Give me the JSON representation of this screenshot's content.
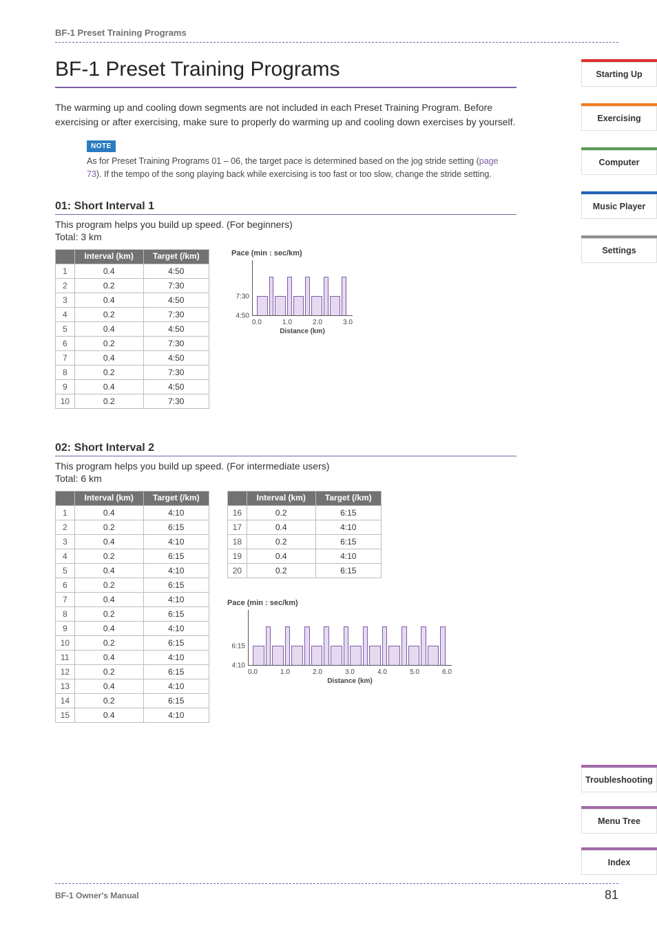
{
  "running_head": "BF-1 Preset Training Programs",
  "page_title": "BF-1 Preset Training Programs",
  "intro": "The warming up and cooling down segments are not included in each Preset Training Program. Before exercising or after exercising, make sure to properly do warming up and cooling down exercises by yourself.",
  "note": {
    "tag": "NOTE",
    "text_a": "As for Preset Training Programs 01 – 06, the target pace is determined based on the jog stride setting (",
    "link": "page 73",
    "text_b": "). If the tempo of the song playing back while exercising is too fast or too slow, change the stride setting."
  },
  "table_headers": {
    "idx": "",
    "interval": "Interval (km)",
    "target": "Target (/km)"
  },
  "program01": {
    "title": "01: Short Interval 1",
    "desc": "This program helps you build up speed. (For beginners)",
    "total": "Total: 3 km",
    "rows": [
      {
        "n": "1",
        "interval": "0.4",
        "target": "4:50"
      },
      {
        "n": "2",
        "interval": "0.2",
        "target": "7:30"
      },
      {
        "n": "3",
        "interval": "0.4",
        "target": "4:50"
      },
      {
        "n": "4",
        "interval": "0.2",
        "target": "7:30"
      },
      {
        "n": "5",
        "interval": "0.4",
        "target": "4:50"
      },
      {
        "n": "6",
        "interval": "0.2",
        "target": "7:30"
      },
      {
        "n": "7",
        "interval": "0.4",
        "target": "4:50"
      },
      {
        "n": "8",
        "interval": "0.2",
        "target": "7:30"
      },
      {
        "n": "9",
        "interval": "0.4",
        "target": "4:50"
      },
      {
        "n": "10",
        "interval": "0.2",
        "target": "7:30"
      }
    ]
  },
  "program02": {
    "title": "02: Short Interval 2",
    "desc": "This program helps you build up speed. (For intermediate users)",
    "total": "Total: 6 km",
    "rows_a": [
      {
        "n": "1",
        "interval": "0.4",
        "target": "4:10"
      },
      {
        "n": "2",
        "interval": "0.2",
        "target": "6:15"
      },
      {
        "n": "3",
        "interval": "0.4",
        "target": "4:10"
      },
      {
        "n": "4",
        "interval": "0.2",
        "target": "6:15"
      },
      {
        "n": "5",
        "interval": "0.4",
        "target": "4:10"
      },
      {
        "n": "6",
        "interval": "0.2",
        "target": "6:15"
      },
      {
        "n": "7",
        "interval": "0.4",
        "target": "4:10"
      },
      {
        "n": "8",
        "interval": "0.2",
        "target": "6:15"
      },
      {
        "n": "9",
        "interval": "0.4",
        "target": "4:10"
      },
      {
        "n": "10",
        "interval": "0.2",
        "target": "6:15"
      },
      {
        "n": "11",
        "interval": "0.4",
        "target": "4:10"
      },
      {
        "n": "12",
        "interval": "0.2",
        "target": "6:15"
      },
      {
        "n": "13",
        "interval": "0.4",
        "target": "4:10"
      },
      {
        "n": "14",
        "interval": "0.2",
        "target": "6:15"
      },
      {
        "n": "15",
        "interval": "0.4",
        "target": "4:10"
      }
    ],
    "rows_b": [
      {
        "n": "16",
        "interval": "0.2",
        "target": "6:15"
      },
      {
        "n": "17",
        "interval": "0.4",
        "target": "4:10"
      },
      {
        "n": "18",
        "interval": "0.2",
        "target": "6:15"
      },
      {
        "n": "19",
        "interval": "0.4",
        "target": "4:10"
      },
      {
        "n": "20",
        "interval": "0.2",
        "target": "6:15"
      }
    ]
  },
  "chart_labels": {
    "title": "Pace (min : sec/km)",
    "xlabel": "Distance (km)"
  },
  "chart_data": [
    {
      "type": "bar",
      "title": "Pace (min : sec/km)",
      "xlabel": "Distance (km)",
      "ylabel": "Pace (min:sec/km)",
      "xlim": [
        0.0,
        3.0
      ],
      "x_ticks": [
        "0.0",
        "1.0",
        "2.0",
        "3.0"
      ],
      "y_ticks": [
        "4:50",
        "7:30"
      ],
      "segments": [
        {
          "width_km": 0.4,
          "pace": "4:50"
        },
        {
          "width_km": 0.2,
          "pace": "7:30"
        },
        {
          "width_km": 0.4,
          "pace": "4:50"
        },
        {
          "width_km": 0.2,
          "pace": "7:30"
        },
        {
          "width_km": 0.4,
          "pace": "4:50"
        },
        {
          "width_km": 0.2,
          "pace": "7:30"
        },
        {
          "width_km": 0.4,
          "pace": "4:50"
        },
        {
          "width_km": 0.2,
          "pace": "7:30"
        },
        {
          "width_km": 0.4,
          "pace": "4:50"
        },
        {
          "width_km": 0.2,
          "pace": "7:30"
        }
      ]
    },
    {
      "type": "bar",
      "title": "Pace (min : sec/km)",
      "xlabel": "Distance (km)",
      "ylabel": "Pace (min:sec/km)",
      "xlim": [
        0.0,
        6.0
      ],
      "x_ticks": [
        "0.0",
        "1.0",
        "2.0",
        "3.0",
        "4.0",
        "5.0",
        "6.0"
      ],
      "y_ticks": [
        "4:10",
        "6:15"
      ],
      "segments": [
        {
          "width_km": 0.4,
          "pace": "4:10"
        },
        {
          "width_km": 0.2,
          "pace": "6:15"
        },
        {
          "width_km": 0.4,
          "pace": "4:10"
        },
        {
          "width_km": 0.2,
          "pace": "6:15"
        },
        {
          "width_km": 0.4,
          "pace": "4:10"
        },
        {
          "width_km": 0.2,
          "pace": "6:15"
        },
        {
          "width_km": 0.4,
          "pace": "4:10"
        },
        {
          "width_km": 0.2,
          "pace": "6:15"
        },
        {
          "width_km": 0.4,
          "pace": "4:10"
        },
        {
          "width_km": 0.2,
          "pace": "6:15"
        },
        {
          "width_km": 0.4,
          "pace": "4:10"
        },
        {
          "width_km": 0.2,
          "pace": "6:15"
        },
        {
          "width_km": 0.4,
          "pace": "4:10"
        },
        {
          "width_km": 0.2,
          "pace": "6:15"
        },
        {
          "width_km": 0.4,
          "pace": "4:10"
        },
        {
          "width_km": 0.2,
          "pace": "6:15"
        },
        {
          "width_km": 0.4,
          "pace": "4:10"
        },
        {
          "width_km": 0.2,
          "pace": "6:15"
        },
        {
          "width_km": 0.4,
          "pace": "4:10"
        },
        {
          "width_km": 0.2,
          "pace": "6:15"
        }
      ]
    }
  ],
  "side_tabs_top": [
    {
      "label": "Starting Up",
      "color": "red"
    },
    {
      "label": "Exercising",
      "color": "orange"
    },
    {
      "label": "Computer",
      "color": "green"
    },
    {
      "label": "Music Player",
      "color": "blue"
    },
    {
      "label": "Settings",
      "color": "grey"
    }
  ],
  "side_tabs_bottom": [
    {
      "label": "Troubleshooting",
      "color": "purple"
    },
    {
      "label": "Menu Tree",
      "color": "purple"
    },
    {
      "label": "Index",
      "color": "purple"
    }
  ],
  "footer": {
    "manual": "BF-1 Owner's Manual",
    "page": "81"
  }
}
